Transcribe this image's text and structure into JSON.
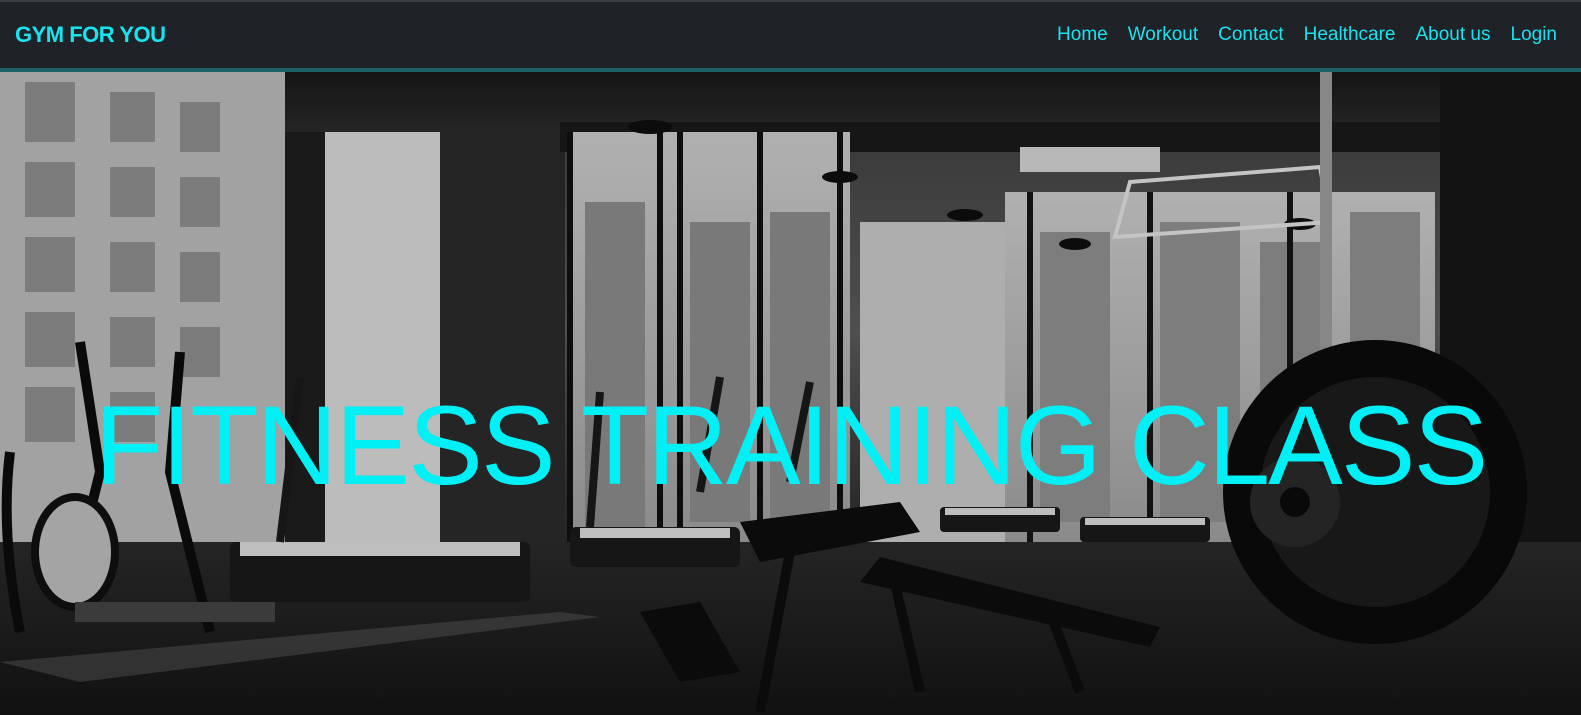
{
  "brand": {
    "name": "GYM FOR YOU"
  },
  "nav": {
    "links": [
      "Home",
      "Workout",
      "Contact",
      "Healthcare",
      "About us",
      "Login"
    ]
  },
  "hero": {
    "title": "FITNESS TRAINING CLASS",
    "background": "gym-interior-photo"
  },
  "colors": {
    "accent": "#19e3ee",
    "navbar_bg": "#1f2227",
    "hero_title": "#00f0f5"
  }
}
